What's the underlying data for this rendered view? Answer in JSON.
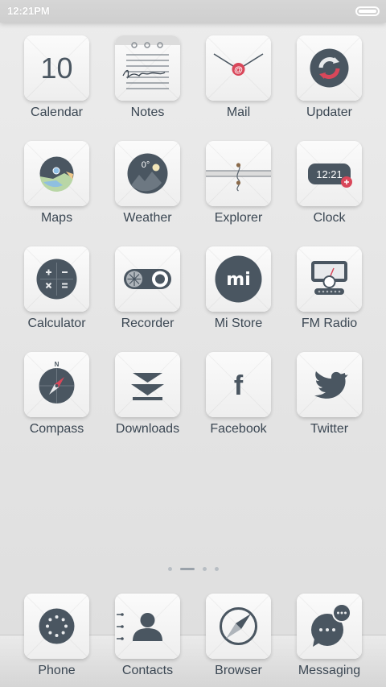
{
  "status_bar": {
    "time": "12:21PM"
  },
  "apps": [
    {
      "id": "calendar",
      "label": "Calendar",
      "icon": "calendar-icon",
      "icon_text": "10"
    },
    {
      "id": "notes",
      "label": "Notes",
      "icon": "notes-icon"
    },
    {
      "id": "mail",
      "label": "Mail",
      "icon": "mail-icon",
      "icon_text": "@"
    },
    {
      "id": "updater",
      "label": "Updater",
      "icon": "updater-icon"
    },
    {
      "id": "maps",
      "label": "Maps",
      "icon": "maps-icon"
    },
    {
      "id": "weather",
      "label": "Weather",
      "icon": "weather-icon",
      "icon_text": "0°"
    },
    {
      "id": "explorer",
      "label": "Explorer",
      "icon": "explorer-icon"
    },
    {
      "id": "clock",
      "label": "Clock",
      "icon": "clock-icon",
      "icon_text": "12:21"
    },
    {
      "id": "calculator",
      "label": "Calculator",
      "icon": "calculator-icon"
    },
    {
      "id": "recorder",
      "label": "Recorder",
      "icon": "recorder-icon"
    },
    {
      "id": "mistore",
      "label": "Mi Store",
      "icon": "mi-store-icon",
      "icon_text": "mi"
    },
    {
      "id": "fmradio",
      "label": "FM Radio",
      "icon": "radio-icon"
    },
    {
      "id": "compass",
      "label": "Compass",
      "icon": "compass-icon",
      "icon_text": "N"
    },
    {
      "id": "downloads",
      "label": "Downloads",
      "icon": "downloads-icon"
    },
    {
      "id": "facebook",
      "label": "Facebook",
      "icon": "facebook-icon",
      "icon_text": "f"
    },
    {
      "id": "twitter",
      "label": "Twitter",
      "icon": "twitter-icon"
    }
  ],
  "page_indicator": {
    "count": 4,
    "active_index": 1
  },
  "dock": [
    {
      "id": "phone",
      "label": "Phone",
      "icon": "phone-icon"
    },
    {
      "id": "contacts",
      "label": "Contacts",
      "icon": "contacts-icon"
    },
    {
      "id": "browser",
      "label": "Browser",
      "icon": "browser-icon"
    },
    {
      "id": "messaging",
      "label": "Messaging",
      "icon": "messaging-icon"
    }
  ],
  "colors": {
    "icon_dark": "#4a5661",
    "accent_red": "#d9475a",
    "label_text": "#3b4753"
  }
}
